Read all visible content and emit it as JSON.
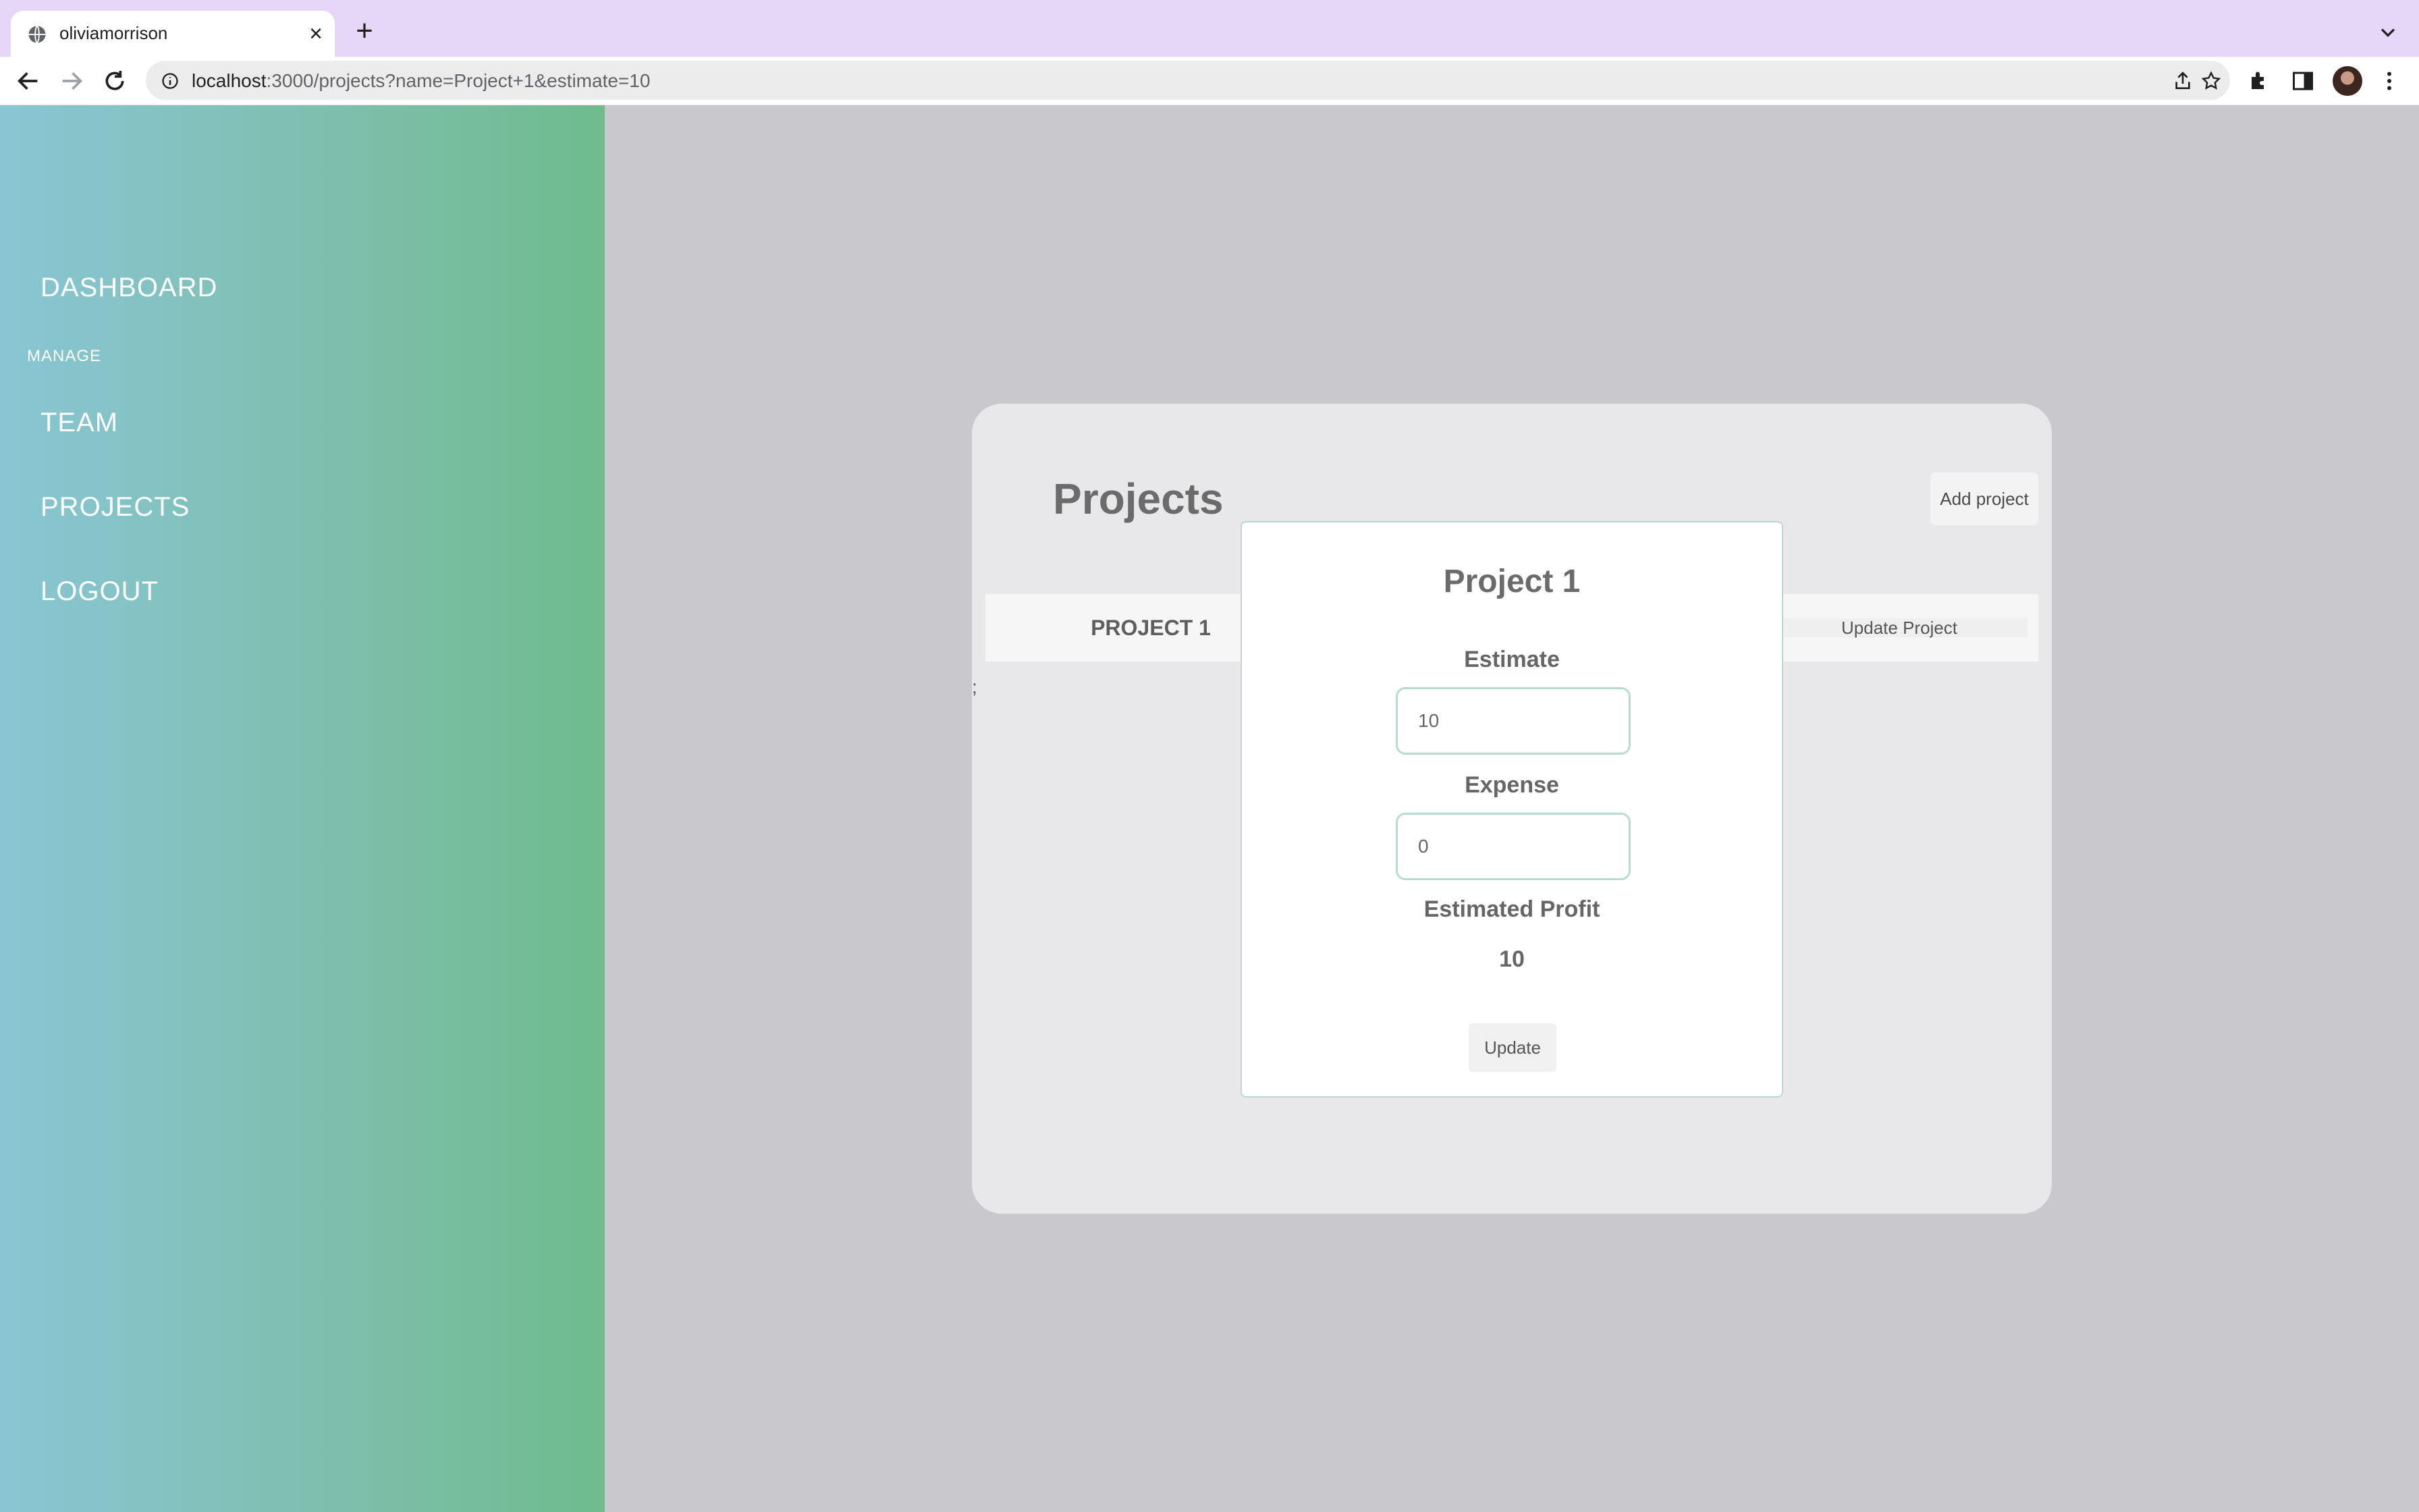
{
  "browser": {
    "tab_title": "oliviamorrison",
    "close_glyph": "×",
    "new_tab_glyph": "+",
    "url_host": "localhost",
    "url_path": ":3000/projects?name=Project+1&estimate=10"
  },
  "sidebar": {
    "dashboard": "DASHBOARD",
    "section_manage": "MANAGE",
    "team": "TEAM",
    "projects": "PROJECTS",
    "logout": "LOGOUT"
  },
  "panel": {
    "title": "Projects",
    "add_button": "Add project",
    "stray_text": ";",
    "rows": [
      {
        "name": "PROJECT 1",
        "update_label": "Update Project"
      }
    ]
  },
  "modal": {
    "title": "Project 1",
    "estimate_label": "Estimate",
    "estimate_value": "10",
    "expense_label": "Expense",
    "expense_value": "0",
    "profit_label": "Estimated Profit",
    "profit_value": "10",
    "update_button": "Update"
  },
  "colors": {
    "tabbar": "#e5d6f8",
    "sidebar_start": "#88c6d4",
    "sidebar_end": "#6fbb8e",
    "main_bg": "#c9c8cd",
    "panel_bg": "#e8e8ea",
    "input_border": "#b6ddd0"
  },
  "icons": [
    "globe-icon",
    "close-icon",
    "plus-icon",
    "chevron-down-icon",
    "back-arrow-icon",
    "forward-arrow-icon",
    "reload-icon",
    "info-icon",
    "share-icon",
    "star-icon",
    "extensions-icon",
    "side-panel-icon",
    "profile-avatar",
    "more-vert-icon"
  ]
}
